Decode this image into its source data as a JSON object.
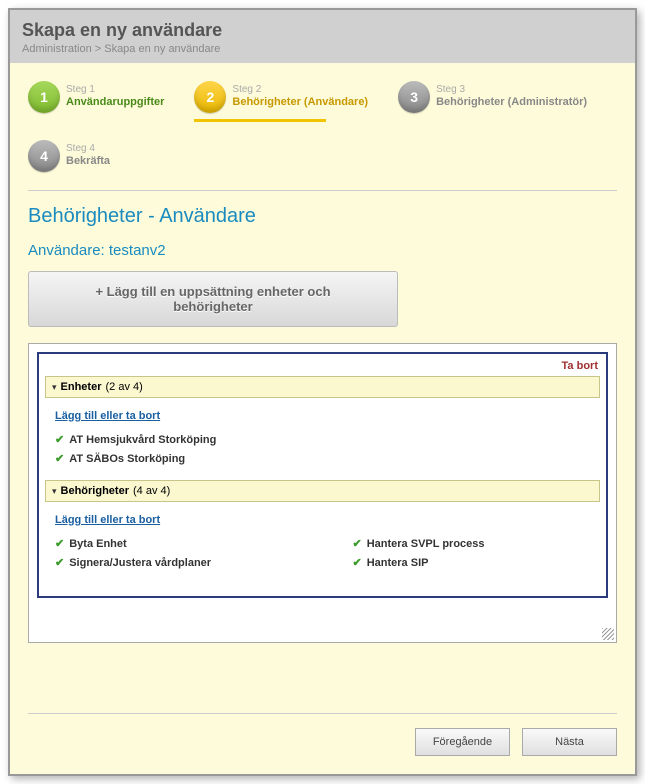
{
  "header": {
    "title": "Skapa en ny användare",
    "breadcrumb": "Administration > Skapa en ny användare"
  },
  "steps": [
    {
      "num": "1",
      "label": "Steg 1",
      "name": "Användaruppgifter",
      "color": "green"
    },
    {
      "num": "2",
      "label": "Steg 2",
      "name": "Behörigheter (Användare)",
      "color": "yellow"
    },
    {
      "num": "3",
      "label": "Steg 3",
      "name": "Behörigheter (Administratör)",
      "color": "grey"
    },
    {
      "num": "4",
      "label": "Steg 4",
      "name": "Bekräfta",
      "color": "grey"
    }
  ],
  "main": {
    "section_title": "Behörigheter - Användare",
    "user_label": "Användare: testanv2",
    "add_set_button": "+ Lägg till en uppsättning enheter och behörigheter",
    "remove_link": "Ta bort",
    "units": {
      "header_label": "Enheter",
      "header_count": "(2 av 4)",
      "add_remove": "Lägg till eller ta bort",
      "items": [
        "AT Hemsjukvård Storköping",
        "AT SÄBOs Storköping"
      ]
    },
    "perms": {
      "header_label": "Behörigheter",
      "header_count": "(4 av 4)",
      "add_remove": "Lägg till eller ta bort",
      "col1": [
        "Byta Enhet",
        "Signera/Justera vårdplaner"
      ],
      "col2": [
        "Hantera SVPL process",
        "Hantera SIP"
      ]
    }
  },
  "footer": {
    "prev": "Föregående",
    "next": "Nästa"
  }
}
